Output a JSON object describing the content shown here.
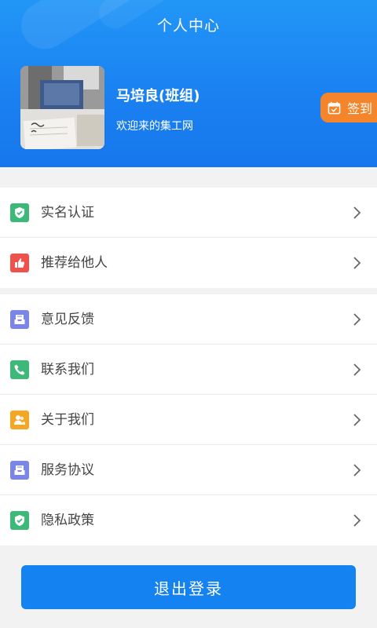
{
  "header": {
    "title": "个人中心",
    "user_name": "马培良(班组)",
    "subtitle": "欢迎来的集工网",
    "checkin_label": "签到",
    "color_gradient_top": "#2296f7",
    "color_gradient_bottom": "#1677ec"
  },
  "menu_group_1": [
    {
      "label": "实名认证",
      "icon": "shield-check-icon",
      "icon_color": "#3cb878"
    },
    {
      "label": "推荐给他人",
      "icon": "thumbs-up-icon",
      "icon_color": "#f2504b"
    }
  ],
  "menu_group_2": [
    {
      "label": "意见反馈",
      "icon": "feedback-tray-icon",
      "icon_color": "#7b84e8"
    },
    {
      "label": "联系我们",
      "icon": "phone-icon",
      "icon_color": "#3cb878"
    },
    {
      "label": "关于我们",
      "icon": "people-icon",
      "icon_color": "#f5a623"
    },
    {
      "label": "服务协议",
      "icon": "agreement-tray-icon",
      "icon_color": "#7b84e8"
    },
    {
      "label": "隐私政策",
      "icon": "privacy-shield-icon",
      "icon_color": "#3cb878"
    }
  ],
  "logout_label": "退出登录",
  "accent_color": "#1582f1",
  "checkin_color": "#f5852b"
}
